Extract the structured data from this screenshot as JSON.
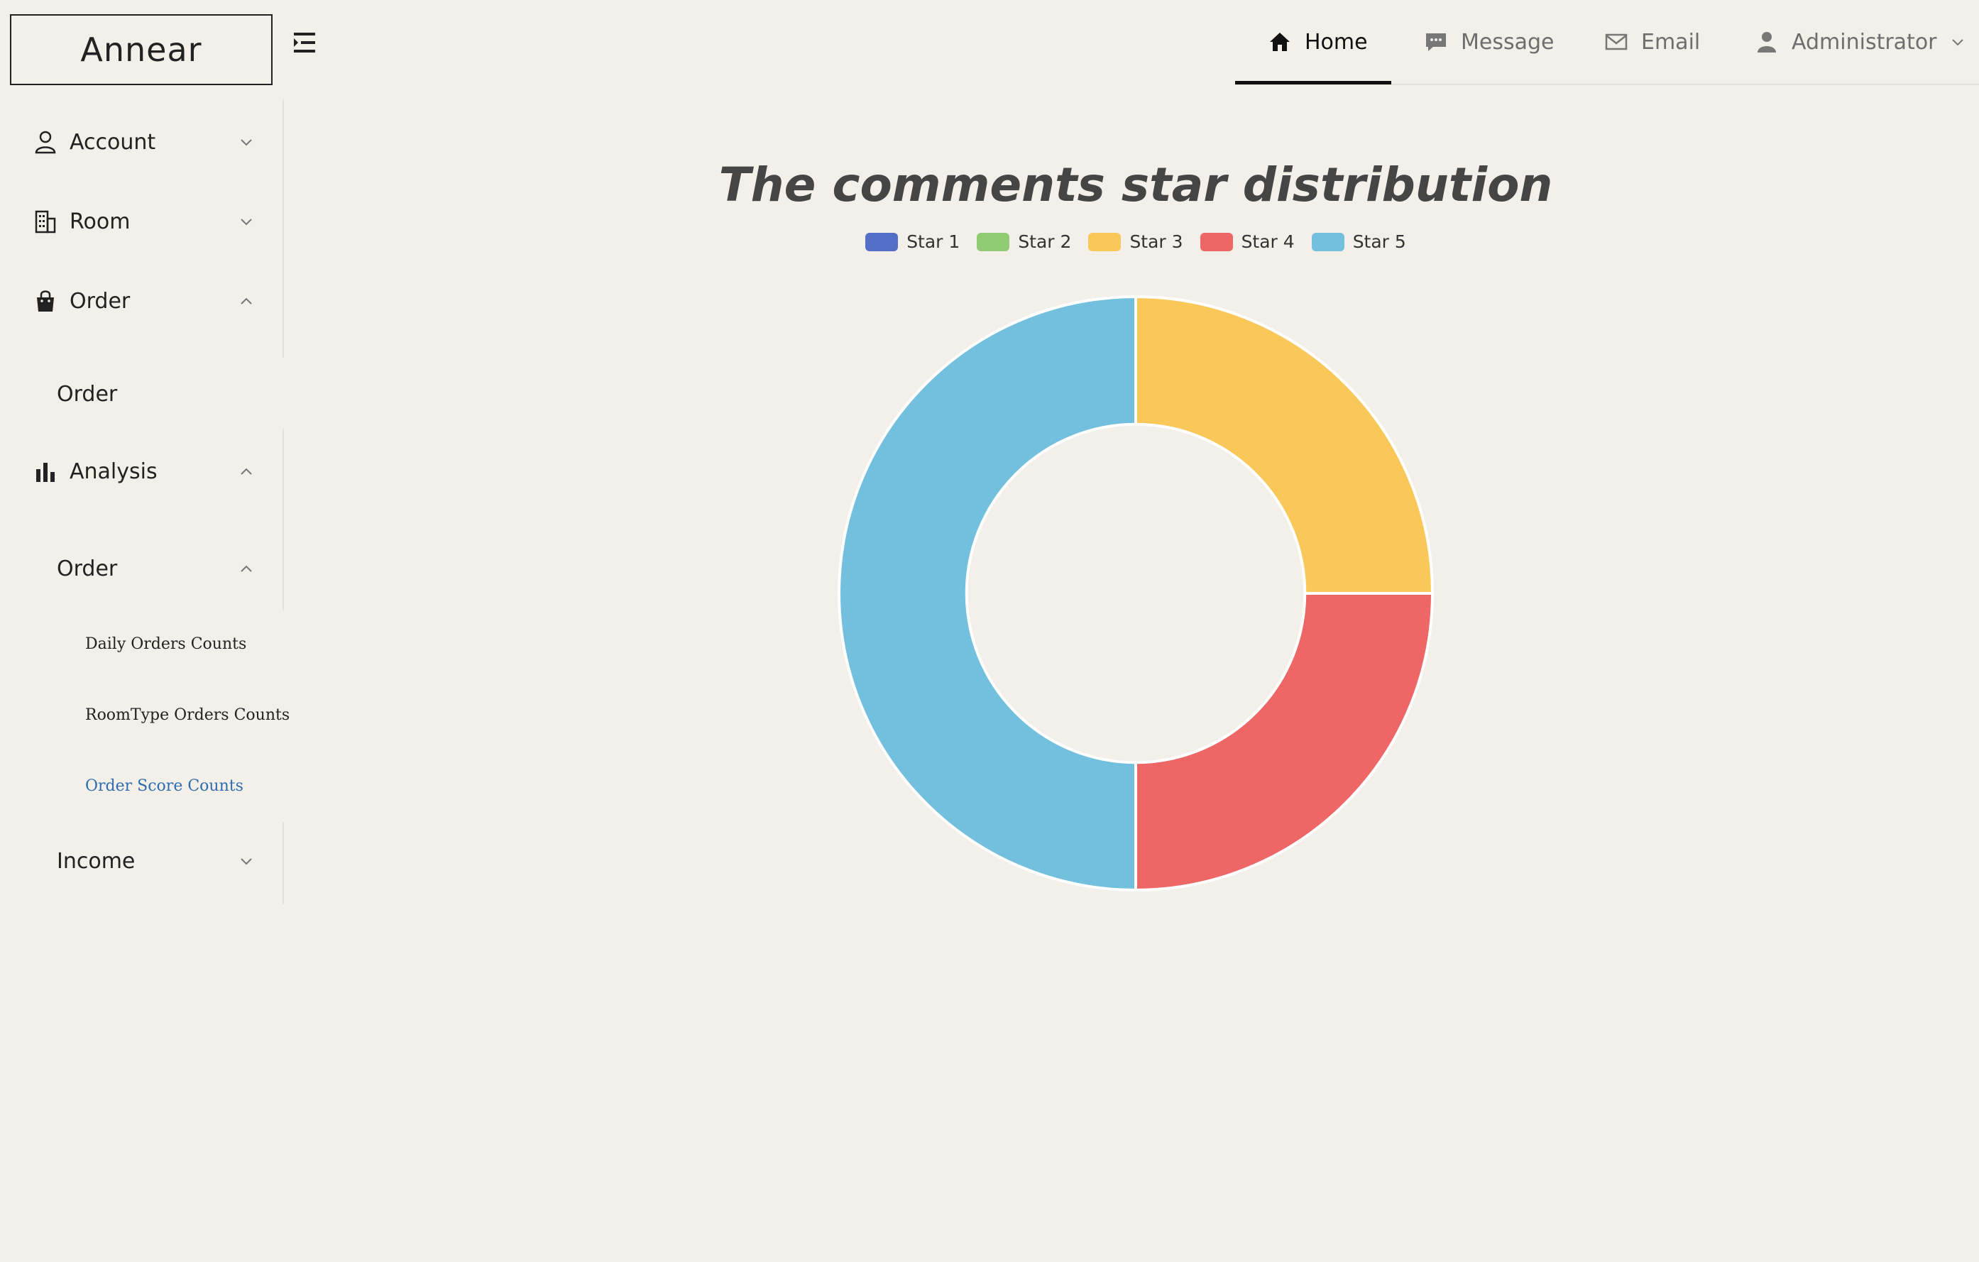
{
  "app": {
    "logo_text": "Annear"
  },
  "topnav": {
    "items": [
      {
        "label": "Home",
        "icon": "home-icon",
        "active": true
      },
      {
        "label": "Message",
        "icon": "message-icon",
        "active": false
      },
      {
        "label": "Email",
        "icon": "email-icon",
        "active": false
      },
      {
        "label": "Administrator",
        "icon": "user-icon",
        "active": false
      }
    ]
  },
  "sidebar": {
    "account": "Account",
    "room": "Room",
    "order": "Order",
    "order_sub": "Order",
    "analysis": "Analysis",
    "analysis_order": "Order",
    "daily_orders": "Daily Orders Counts",
    "roomtype_orders": "RoomType Orders Counts",
    "order_score": "Order Score Counts",
    "income": "Income"
  },
  "colors": {
    "background": "#f3efe9",
    "active_link": "#2f6db0"
  },
  "chart_data": {
    "type": "pie",
    "title": "The comments star distribution",
    "legend_position": "top",
    "categories": [
      "Star 1",
      "Star 2",
      "Star 3",
      "Star 4",
      "Star 5"
    ],
    "values": [
      0,
      0,
      1,
      1,
      2
    ],
    "colors": [
      "#5470c6",
      "#91cc75",
      "#fac858",
      "#ee6666",
      "#73c0de"
    ],
    "inner_radius_ratio": 0.57
  }
}
